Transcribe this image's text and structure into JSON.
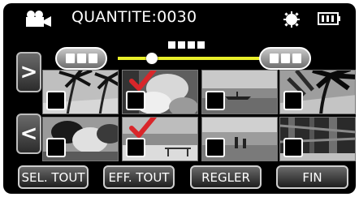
{
  "header": {
    "count_text": "QUANTITE:0030"
  },
  "nav": {
    "next_symbol": ">",
    "prev_symbol": "<"
  },
  "thumbnails": [
    {
      "checked": false
    },
    {
      "checked": true
    },
    {
      "checked": false
    },
    {
      "checked": false
    },
    {
      "checked": false
    },
    {
      "checked": true
    },
    {
      "checked": false
    },
    {
      "checked": false
    }
  ],
  "buttons": {
    "select_all": "SEL. TOUT",
    "clear_all": "EFF. TOUT",
    "set": "REGLER",
    "end": "FIN"
  },
  "colors": {
    "slider": "#e9ef2a",
    "check": "#d9262a"
  }
}
